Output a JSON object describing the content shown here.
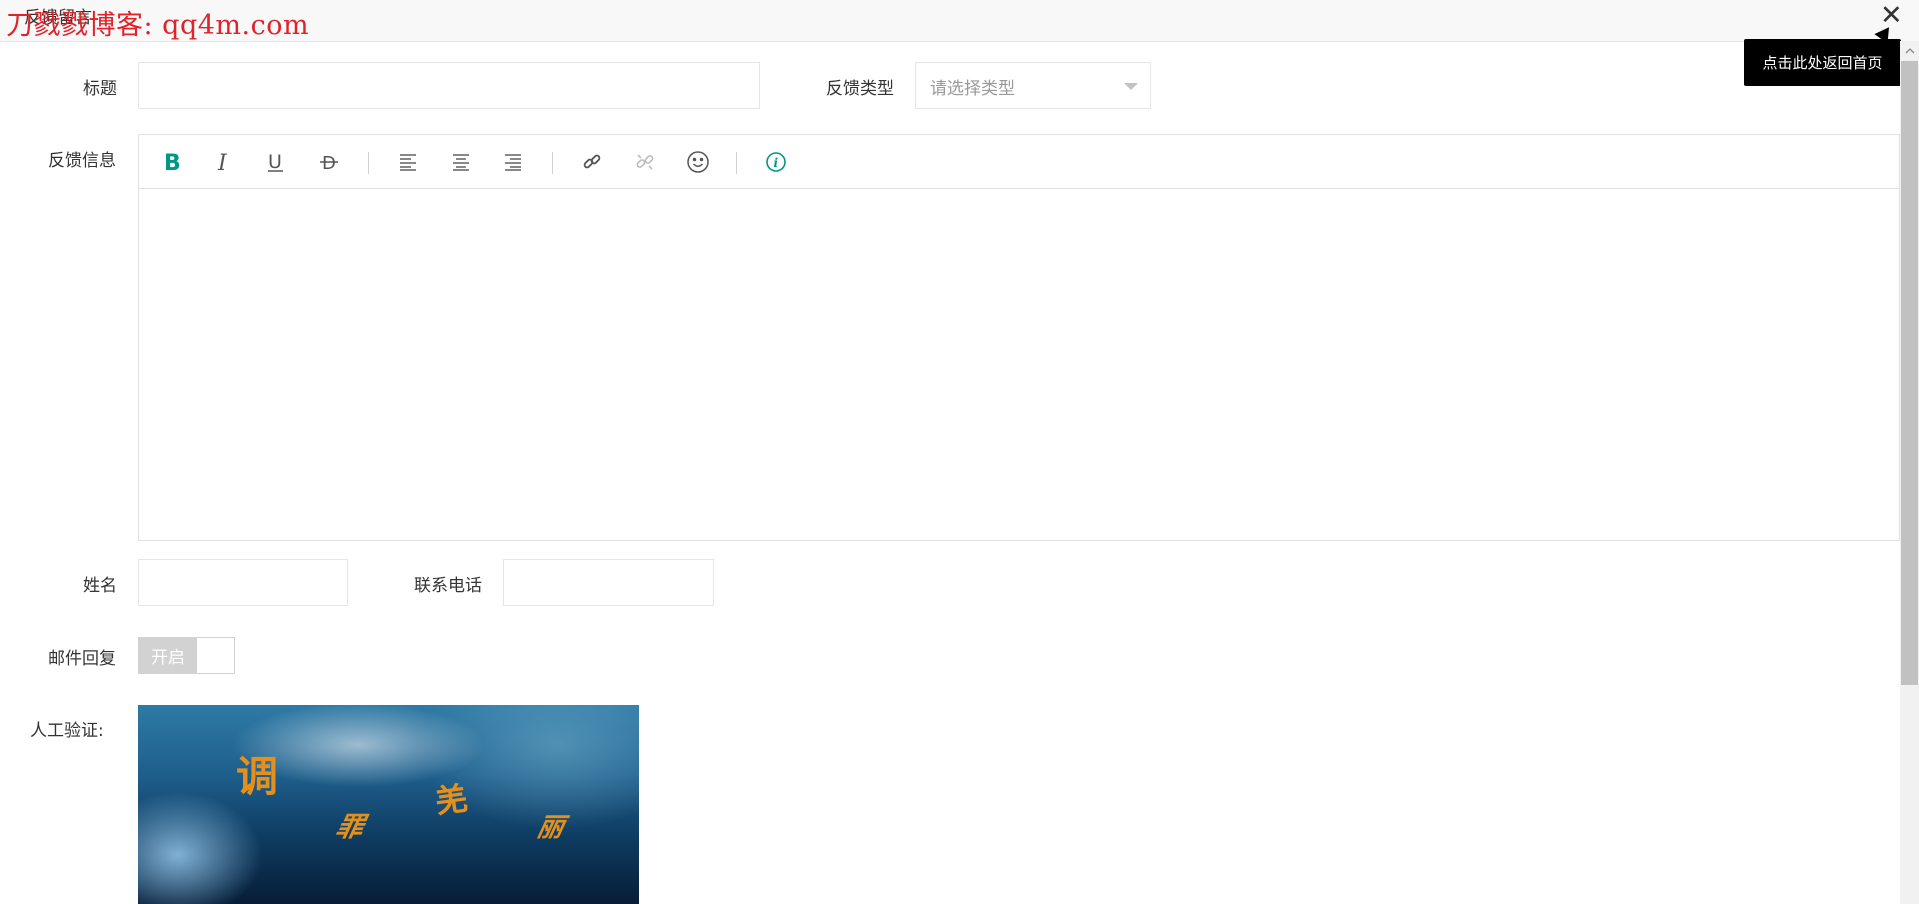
{
  "topbar": {
    "title": "反馈留言",
    "watermark": "刀戮戮博客: qq4m.com",
    "close_symbol": "✕"
  },
  "tooltip": {
    "text": "点击此处返回首页"
  },
  "form": {
    "title_label": "标题",
    "title_value": "",
    "type_label": "反馈类型",
    "type_placeholder": "请选择类型",
    "feedback_label": "反馈信息",
    "name_label": "姓名",
    "name_value": "",
    "phone_label": "联系电话",
    "phone_value": "",
    "email_reply_label": "邮件回复",
    "email_reply_switch": "开启",
    "email_reply_on": false,
    "captcha_label": "人工验证:",
    "captcha_chars": [
      "调",
      "羌",
      "罪",
      "丽"
    ]
  },
  "editor_toolbar": [
    {
      "icon": "bold-icon"
    },
    {
      "icon": "italic-icon"
    },
    {
      "icon": "underline-icon"
    },
    {
      "icon": "strikethrough-icon"
    },
    {
      "icon": "align-left-icon"
    },
    {
      "icon": "align-center-icon"
    },
    {
      "icon": "align-right-icon"
    },
    {
      "icon": "link-icon"
    },
    {
      "icon": "unlink-icon"
    },
    {
      "icon": "emoji-icon"
    },
    {
      "icon": "help-icon"
    }
  ],
  "colors": {
    "accent": "#009688",
    "tooltip_bg": "#000000",
    "captcha_text": "#e5901c",
    "watermark": "#e0232b"
  }
}
